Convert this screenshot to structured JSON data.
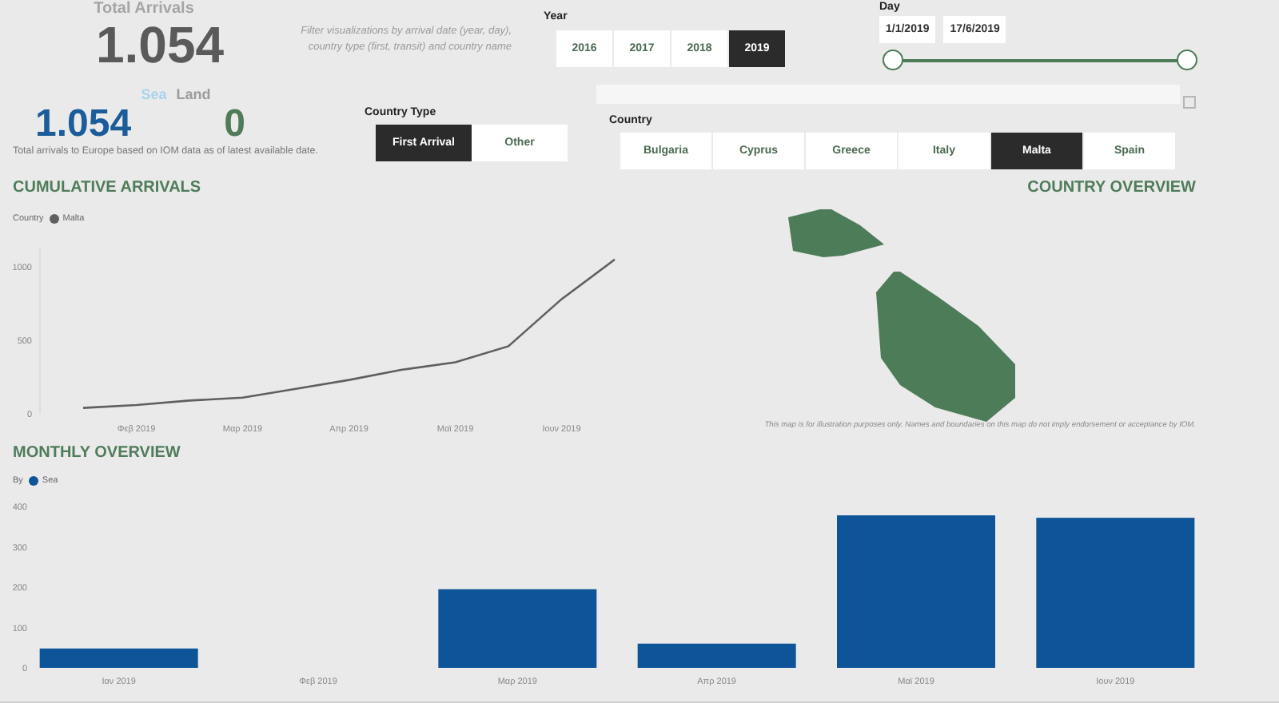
{
  "kpi": {
    "title": "Total Arrivals",
    "total": "1.054",
    "legend": [
      {
        "label": "Sea",
        "color": "#a8d4ec"
      },
      {
        "label": "Land",
        "color": "#9c9c9c"
      }
    ],
    "sea_total": "1.054",
    "land_total": "0",
    "caption": "Total arrivals to Europe based on IOM data as of latest available date."
  },
  "filter_note": "Filter visualizations by arrival date (year, day), country type (first, transit) and country name",
  "year": {
    "label": "Year",
    "options": [
      {
        "label": "2016",
        "selected": false
      },
      {
        "label": "2017",
        "selected": false
      },
      {
        "label": "2018",
        "selected": false
      },
      {
        "label": "2019",
        "selected": true
      }
    ]
  },
  "day": {
    "label": "Day",
    "start": "1/1/2019",
    "end": "17/6/2019",
    "thumbs": [
      {
        "level": 0
      },
      {
        "level": 1
      }
    ]
  },
  "country_type": {
    "label": "Country Type",
    "options": [
      {
        "label": "First Arrival",
        "selected": true
      },
      {
        "label": "Other",
        "selected": false
      }
    ]
  },
  "country": {
    "label": "Country",
    "options": [
      {
        "label": "Bulgaria",
        "selected": false
      },
      {
        "label": "Cyprus",
        "selected": false
      },
      {
        "label": "Greece",
        "selected": false
      },
      {
        "label": "Italy",
        "selected": false
      },
      {
        "label": "Malta",
        "selected": true
      },
      {
        "label": "Spain",
        "selected": false
      }
    ]
  },
  "cumulative": {
    "title": "CUMULATIVE ARRIVALS",
    "legend_label": "Country",
    "chart_data": {
      "type": "line",
      "categories": [
        null,
        "Φεβ 2019",
        null,
        "Μαρ 2019",
        null,
        "Απρ 2019",
        null,
        "Μαϊ 2019",
        null,
        "Ιουν 2019",
        null
      ],
      "series": [
        {
          "name": "Malta",
          "color": "#5f5f5f",
          "values": [
            40,
            60,
            90,
            110,
            170,
            230,
            300,
            350,
            460,
            780,
            1050
          ]
        }
      ],
      "ylim": [
        0,
        1130
      ],
      "yticks": [
        0,
        500,
        1000
      ]
    }
  },
  "country_overview": {
    "title": "COUNTRY OVERVIEW",
    "note": "This map is for illustration purposes only. Names and boundaries on this map do not imply endorsement or acceptance by IOM."
  },
  "monthly": {
    "title": "MONTHLY OVERVIEW",
    "legend_label": "By",
    "chart_data": {
      "type": "bar",
      "categories": [
        "Ιαν 2019",
        "Φεβ 2019",
        "Μαρ 2019",
        "Απρ 2019",
        "Μαϊ 2019",
        "Ιουν 2019"
      ],
      "series": [
        {
          "name": "Sea",
          "color": "#0e5499",
          "values": [
            48,
            0,
            195,
            60,
            378,
            372
          ]
        }
      ],
      "ylim": [
        0,
        400
      ],
      "yticks": [
        0,
        100,
        200,
        300,
        400
      ]
    }
  }
}
